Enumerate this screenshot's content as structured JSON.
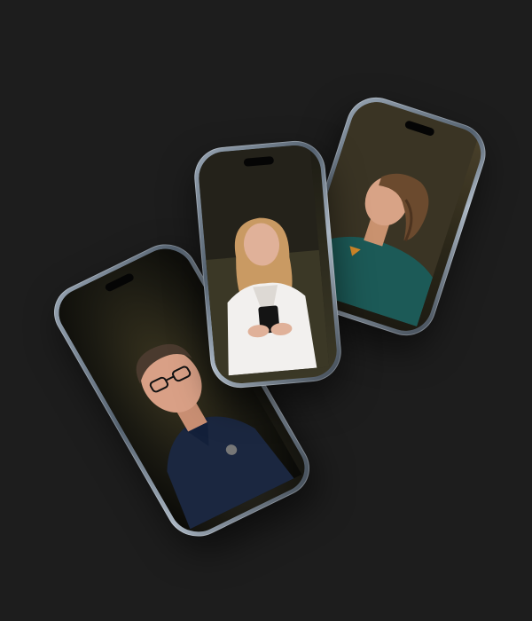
{
  "scene": {
    "background_color": "#1d1d1d",
    "phones": [
      {
        "subject": "man-with-glasses",
        "shirt_color": "#1b2740",
        "screen_tone": "#2b2a22"
      },
      {
        "subject": "woman-in-white-blazer",
        "shirt_color": "#f2f0ee",
        "screen_tone": "#2c2a1d"
      },
      {
        "subject": "young-man-long-hair",
        "shirt_color": "#1c5a57",
        "screen_tone": "#4a412b"
      }
    ]
  }
}
